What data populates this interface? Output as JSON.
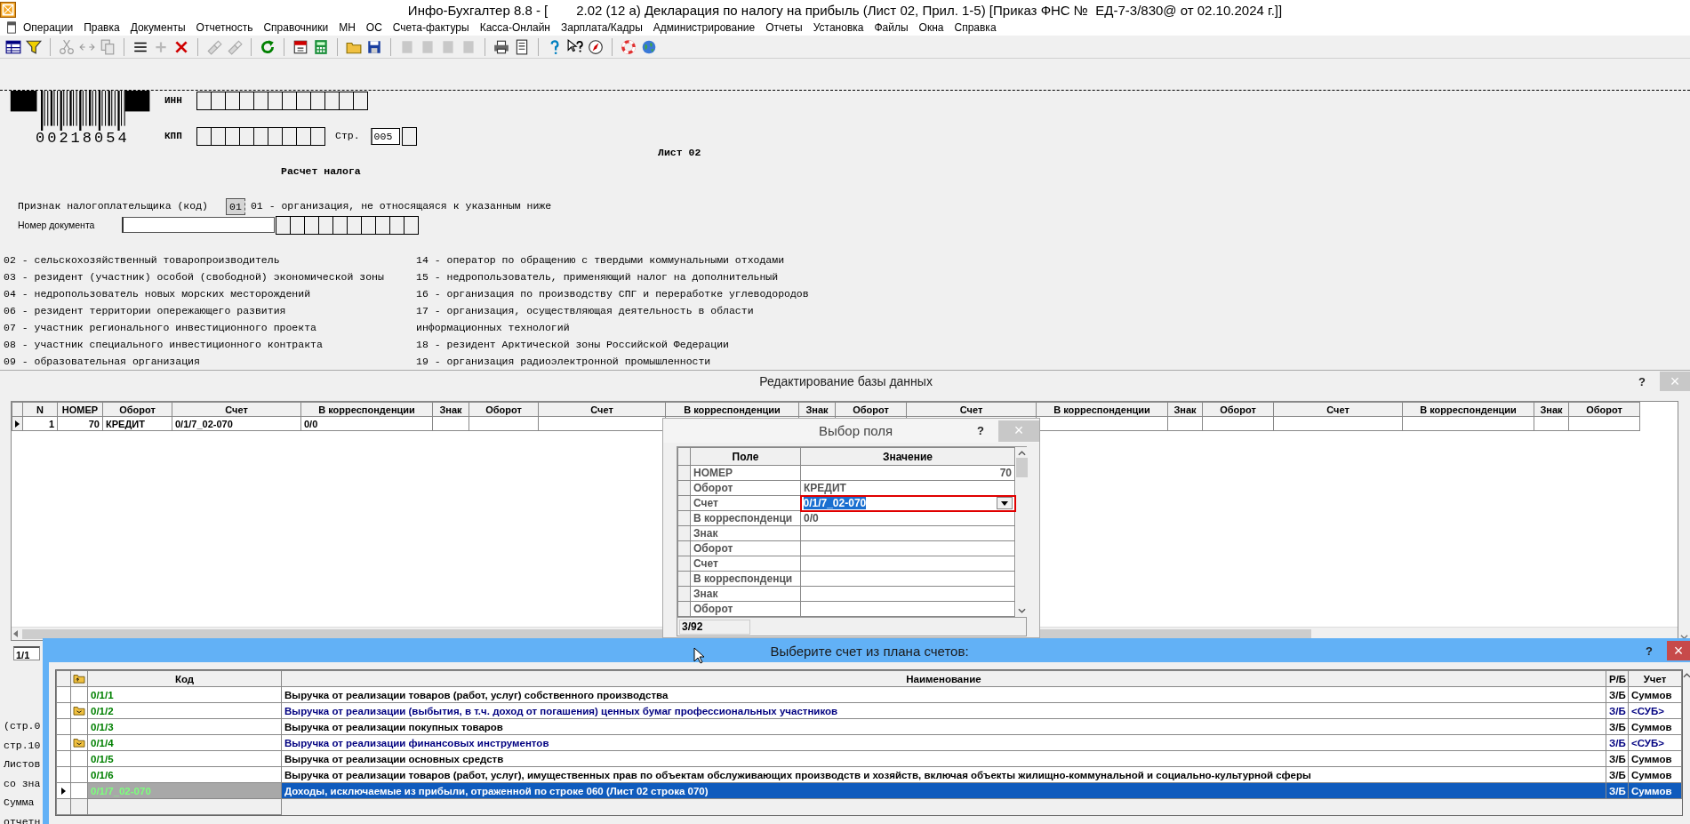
{
  "window": {
    "app_title": "Инфо-Бухгалтер 8.8 - [",
    "document_title": "2.02 (12 а) Декларация по налогу на прибыль (Лист 02, Прил. 1-5) [Приказ ФНС №  ЕД-7-3/830@ от 02.10.2024 г.]]"
  },
  "menu": [
    "Операции",
    "Правка",
    "Документы",
    "Отчетность",
    "Справочники",
    "МН",
    "ОС",
    "Счета-фактуры",
    "Касса-Онлайн",
    "Зарплата/Кадры",
    "Администрирование",
    "Отчеты",
    "Установка",
    "Файлы",
    "Окна",
    "Справка"
  ],
  "toolbar": [
    [
      {
        "disabled": false
      },
      {
        "disabled": false
      }
    ],
    [
      {
        "disabled": true
      },
      {
        "disabled": true
      },
      {
        "disabled": true
      }
    ],
    [
      {
        "disabled": false
      },
      {
        "disabled": true
      },
      {
        "disabled": false
      }
    ],
    [
      {
        "disabled": true
      },
      {
        "disabled": true
      }
    ],
    [
      {
        "disabled": false
      }
    ],
    [
      {
        "disabled": false
      },
      {
        "disabled": false
      }
    ],
    [
      {
        "disabled": false
      },
      {
        "disabled": false
      }
    ],
    [
      {
        "disabled": true
      },
      {
        "disabled": true
      },
      {
        "disabled": true
      },
      {
        "disabled": true
      }
    ],
    [
      {
        "disabled": false
      },
      {
        "disabled": false
      }
    ],
    [
      {
        "disabled": false
      },
      {
        "disabled": false
      },
      {
        "disabled": false
      }
    ],
    [
      {
        "disabled": false
      },
      {
        "disabled": false
      }
    ]
  ],
  "form": {
    "barcode": "00218054",
    "inn_label": "ИНН",
    "kpp_label": "КПП",
    "page_label": "Стр.",
    "page": "005",
    "sheet": "Лист 02",
    "heading": "Расчет налога",
    "taxpayer_label": "Признак налогоплательщика (код)",
    "taxpayer_code": "01",
    "taxpayer_desc": "01 - организация, не относящаяся к указанным ниже",
    "doc_number_label": "Номер документа",
    "codes_left": [
      "02 - сельскохозяйственный товаропроизводитель",
      "03 - резидент (участник) особой (свободной) экономической зоны",
      "04 - недропользователь новых морских месторождений",
      "06 - резидент территории опережающего развития",
      "07 - участник регионального инвестиционного проекта",
      "08 - участник специального инвестиционного контракта",
      "09 - образовательная организация"
    ],
    "codes_right": [
      "14 - оператор по обращению с твердыми коммунальными отходами",
      "15 - недропользователь, применяющий налог на дополнительный",
      "16 - организация по производству СПГ и переработке углеводородов",
      "17 - организация, осуществляющая деятельность в области",
      "информационных технологий",
      "18 - резидент Арктической зоны Российской Федерации",
      "19 - организация радиоэлектронной промышленности"
    ],
    "peek_lines": [
      "(стр.0",
      "стр.10",
      "Листов",
      "со зна",
      "Сумма",
      "отчетн"
    ]
  },
  "db_window": {
    "title": "Редактирование базы данных",
    "help": "?",
    "close": "×",
    "columns": [
      "N",
      "НОМЕР",
      "Оборот",
      "Счет",
      "В корреспонденции",
      "Знак",
      "Оборот",
      "Счет",
      "В корреспонденции",
      "Знак",
      "Оборот",
      "Счет",
      "В корреспонденции",
      "Знак",
      "Оборот",
      "Счет",
      "В корреспонденции",
      "Знак",
      "Оборот"
    ],
    "rows": [
      {
        "selected": true,
        "cells": [
          "1",
          "70",
          "КРЕДИТ",
          "0/1/7_02-070",
          "0/0"
        ]
      }
    ],
    "position": "1/1"
  },
  "field_dialog": {
    "title": "Выбор поля",
    "help": "?",
    "close": "×",
    "columns": [
      "Поле",
      "Значение"
    ],
    "rows": [
      {
        "field": "НОМЕР",
        "value": "70",
        "kind": "number",
        "selected": false
      },
      {
        "field": "Оборот",
        "value": "КРЕДИТ",
        "kind": "text",
        "selected": false
      },
      {
        "field": "Счет",
        "value": "0/1/7_02-070",
        "kind": "text",
        "selected": true
      },
      {
        "field": "В корреспонденци",
        "value": "0/0",
        "kind": "text",
        "selected": false
      },
      {
        "field": "Знак",
        "kind": "text",
        "selected": false
      },
      {
        "field": "Оборот",
        "kind": "text",
        "selected": false
      },
      {
        "field": "Счет",
        "kind": "text",
        "selected": false
      },
      {
        "field": "В корреспонденци",
        "kind": "text",
        "selected": false
      },
      {
        "field": "Знак",
        "kind": "text",
        "selected": false
      },
      {
        "field": "Оборот",
        "kind": "text",
        "selected": false
      }
    ],
    "position": "3/92"
  },
  "account_window": {
    "title": "Выберите счет из плана счетов:",
    "help": "?",
    "close": "×",
    "columns": [
      "Код",
      "Наименование",
      "Р/Б",
      "Учет"
    ],
    "rows": [
      {
        "kind": "account",
        "selected": false,
        "code": "0/1/1",
        "name": "Выручка от реализации товаров (работ, услуг) собственного производства",
        "rb": "З/Б",
        "accounting": "Суммов"
      },
      {
        "kind": "folder",
        "selected": false,
        "code": "0/1/2",
        "name": "Выручка от реализации (выбытия, в т.ч. доход от погашения) ценных бумаг профессиональных участников",
        "rb": "З/Б",
        "accounting": "<СУБ>"
      },
      {
        "kind": "account",
        "selected": false,
        "code": "0/1/3",
        "name": "Выручка от реализации покупных товаров",
        "rb": "З/Б",
        "accounting": "Суммов"
      },
      {
        "kind": "folder",
        "selected": false,
        "code": "0/1/4",
        "name": "Выручка от реализации финансовых инструментов",
        "rb": "З/Б",
        "accounting": "<СУБ>"
      },
      {
        "kind": "account",
        "selected": false,
        "code": "0/1/5",
        "name": "Выручка от реализации основных средств",
        "rb": "З/Б",
        "accounting": "Суммов"
      },
      {
        "kind": "account",
        "selected": false,
        "code": "0/1/6",
        "name": "Выручка от реализации товаров (работ, услуг), имущественных прав по объектам обслуживающих производств и хозяйств, включая объекты жилищно-коммунальной и социально-культурной сферы",
        "rb": "З/Б",
        "accounting": "Суммов"
      },
      {
        "kind": "account",
        "selected": true,
        "code": "0/1/7_02-070",
        "name": "Доходы, исключаемые из прибыли, отраженной по строке 060 (Лист 02 строка 070)",
        "rb": "З/Б",
        "accounting": "Суммов"
      }
    ]
  }
}
